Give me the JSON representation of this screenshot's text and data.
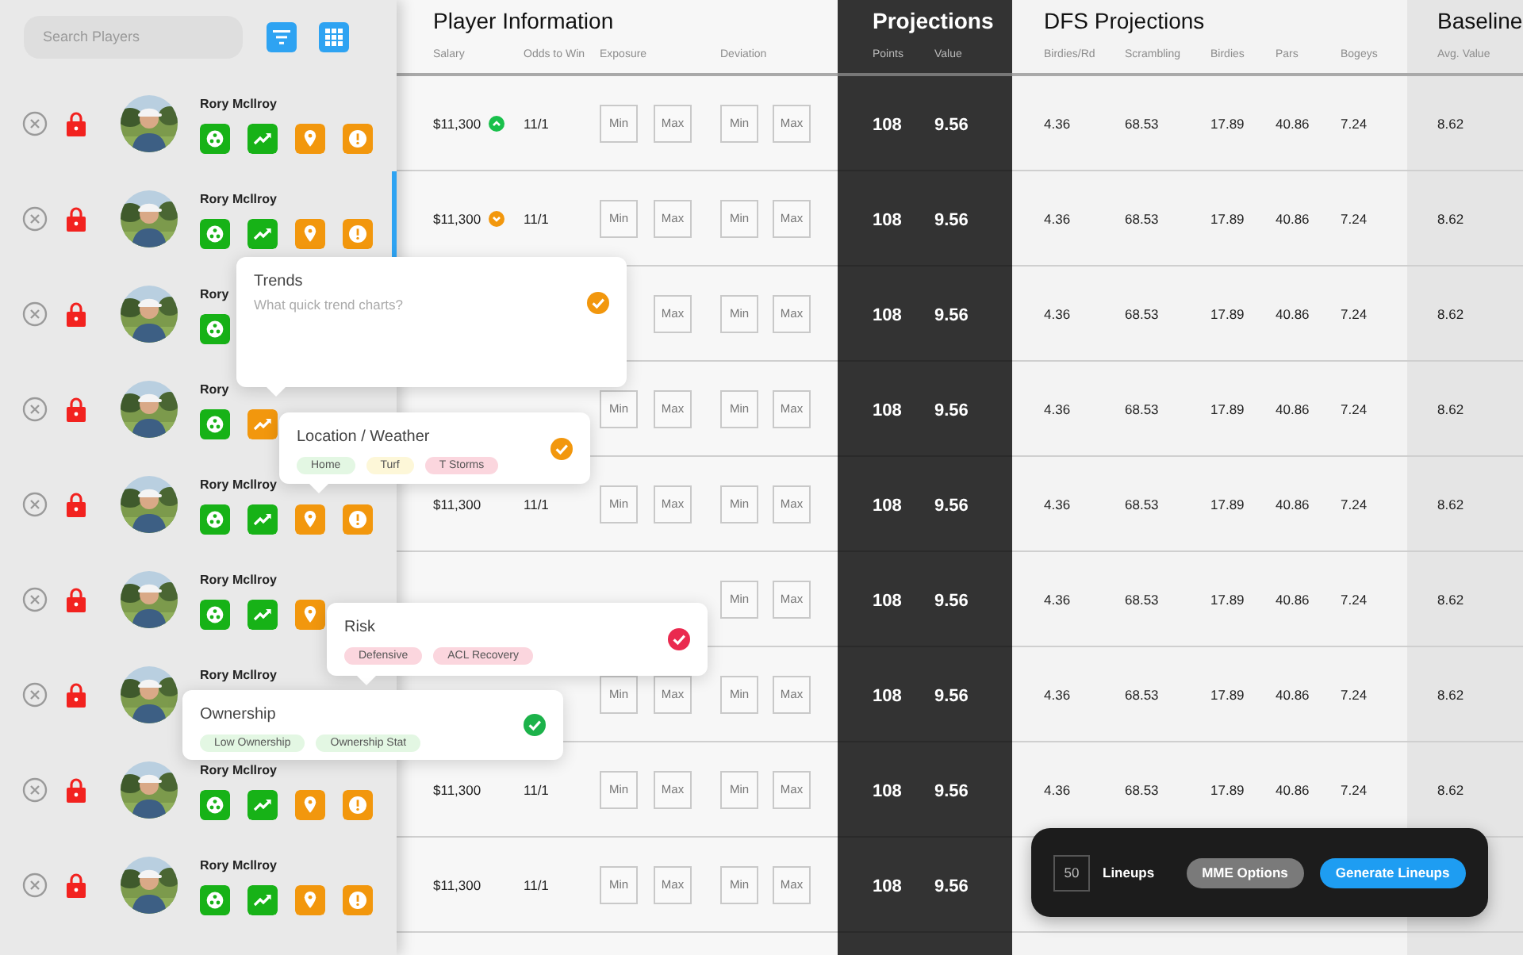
{
  "sidebar": {
    "search": {
      "placeholder": "Search Players"
    },
    "players": [
      {
        "name": "Rory Mcllroy",
        "icons": [
          {
            "kind": "people",
            "color": "#17b217"
          },
          {
            "kind": "trend",
            "color": "#17b217"
          },
          {
            "kind": "location",
            "color": "#f2970d"
          },
          {
            "kind": "alert",
            "color": "#f2970d"
          }
        ]
      },
      {
        "name": "Rory Mcllroy",
        "icons": [
          {
            "kind": "people",
            "color": "#17b217"
          },
          {
            "kind": "trend",
            "color": "#17b217"
          },
          {
            "kind": "location",
            "color": "#f2970d"
          },
          {
            "kind": "alert",
            "color": "#f2970d"
          }
        ]
      },
      {
        "name": "Rory",
        "icons": [
          {
            "kind": "people",
            "color": "#17b217"
          }
        ]
      },
      {
        "name": "Rory",
        "icons": [
          {
            "kind": "people",
            "color": "#17b217"
          },
          {
            "kind": "trend",
            "color": "#f2970d"
          }
        ]
      },
      {
        "name": "Rory Mcllroy",
        "icons": [
          {
            "kind": "people",
            "color": "#17b217"
          },
          {
            "kind": "trend",
            "color": "#17b217"
          },
          {
            "kind": "location",
            "color": "#f2970d"
          },
          {
            "kind": "alert",
            "color": "#f2970d"
          }
        ]
      },
      {
        "name": "Rory Mcllroy",
        "icons": [
          {
            "kind": "people",
            "color": "#17b217"
          },
          {
            "kind": "trend",
            "color": "#17b217"
          },
          {
            "kind": "location",
            "color": "#f2970d"
          }
        ]
      },
      {
        "name": "Rory Mcllroy"
      },
      {
        "name": "Rory Mcllroy",
        "icons": [
          {
            "kind": "people",
            "color": "#17b217"
          },
          {
            "kind": "trend",
            "color": "#17b217"
          },
          {
            "kind": "location",
            "color": "#f2970d"
          },
          {
            "kind": "alert",
            "color": "#f2970d"
          }
        ]
      },
      {
        "name": "Rory Mcllroy",
        "icons": [
          {
            "kind": "people",
            "color": "#17b217"
          },
          {
            "kind": "trend",
            "color": "#17b217"
          },
          {
            "kind": "location",
            "color": "#f2970d"
          },
          {
            "kind": "alert",
            "color": "#f2970d"
          }
        ]
      }
    ]
  },
  "sections": [
    {
      "kind": "info",
      "title": "Player Information",
      "columns": [
        "Salary",
        "Odds to Win",
        "Exposure",
        "Deviation"
      ]
    },
    {
      "kind": "projections",
      "title": "Projections",
      "columns": [
        "Points",
        "Value"
      ]
    },
    {
      "kind": "dfs",
      "title": "DFS Projections",
      "columns": [
        "Birdies/Rd",
        "Scrambling",
        "Birdies",
        "Pars",
        "Bogeys"
      ]
    },
    {
      "kind": "baseline",
      "title": "Baseline",
      "columns": [
        "Avg. Value"
      ]
    }
  ],
  "rows": [
    {
      "salary": "$11,300",
      "trend": {
        "kind": "up"
      },
      "odds": "11/1",
      "exposure": {
        "min": {
          "placeholder": "Min"
        },
        "max": {
          "placeholder": "Max"
        }
      },
      "deviation": {
        "min": {
          "placeholder": "Min"
        },
        "max": {
          "placeholder": "Max"
        }
      },
      "points": "108",
      "value": "9.56",
      "dfs": [
        "4.36",
        "68.53",
        "17.89",
        "40.86",
        "7.24"
      ],
      "baseline": "8.62"
    },
    {
      "salary": "$11,300",
      "trend": {
        "kind": "down"
      },
      "odds": "11/1",
      "exposure": {
        "min": {
          "placeholder": "Min"
        },
        "max": {
          "placeholder": "Max"
        }
      },
      "deviation": {
        "min": {
          "placeholder": "Min"
        },
        "max": {
          "placeholder": "Max"
        }
      },
      "points": "108",
      "value": "9.56",
      "dfs": [
        "4.36",
        "68.53",
        "17.89",
        "40.86",
        "7.24"
      ],
      "baseline": "8.62"
    },
    {
      "exposure": {
        "max": {
          "placeholder": "Max"
        }
      },
      "deviation": {
        "min": {
          "placeholder": "Min"
        },
        "max": {
          "placeholder": "Max"
        }
      },
      "points": "108",
      "value": "9.56",
      "dfs": [
        "4.36",
        "68.53",
        "17.89",
        "40.86",
        "7.24"
      ],
      "baseline": "8.62"
    },
    {
      "exposure": {
        "min": {
          "placeholder": "Min"
        },
        "max": {
          "placeholder": "Max"
        }
      },
      "deviation": {
        "min": {
          "placeholder": "Min"
        },
        "max": {
          "placeholder": "Max"
        }
      },
      "points": "108",
      "value": "9.56",
      "dfs": [
        "4.36",
        "68.53",
        "17.89",
        "40.86",
        "7.24"
      ],
      "baseline": "8.62"
    },
    {
      "salary": "$11,300",
      "odds": "11/1",
      "exposure": {
        "min": {
          "placeholder": "Min"
        },
        "max": {
          "placeholder": "Max"
        }
      },
      "deviation": {
        "min": {
          "placeholder": "Min"
        },
        "max": {
          "placeholder": "Max"
        }
      },
      "points": "108",
      "value": "9.56",
      "dfs": [
        "4.36",
        "68.53",
        "17.89",
        "40.86",
        "7.24"
      ],
      "baseline": "8.62"
    },
    {
      "deviation": {
        "min": {
          "placeholder": "Min"
        },
        "max": {
          "placeholder": "Max"
        }
      },
      "points": "108",
      "value": "9.56",
      "dfs": [
        "4.36",
        "68.53",
        "17.89",
        "40.86",
        "7.24"
      ],
      "baseline": "8.62"
    },
    {
      "exposure": {
        "min": {
          "placeholder": "Min"
        },
        "max": {
          "placeholder": "Max"
        }
      },
      "deviation": {
        "min": {
          "placeholder": "Min"
        },
        "max": {
          "placeholder": "Max"
        }
      },
      "points": "108",
      "value": "9.56",
      "dfs": [
        "4.36",
        "68.53",
        "17.89",
        "40.86",
        "7.24"
      ],
      "baseline": "8.62"
    },
    {
      "salary": "$11,300",
      "odds": "11/1",
      "exposure": {
        "min": {
          "placeholder": "Min"
        },
        "max": {
          "placeholder": "Max"
        }
      },
      "deviation": {
        "min": {
          "placeholder": "Min"
        },
        "max": {
          "placeholder": "Max"
        }
      },
      "points": "108",
      "value": "9.56",
      "dfs": [
        "4.36",
        "68.53",
        "17.89",
        "40.86",
        "7.24"
      ],
      "baseline": "8.62"
    },
    {
      "salary": "$11,300",
      "odds": "11/1",
      "exposure": {
        "min": {
          "placeholder": "Min"
        },
        "max": {
          "placeholder": "Max"
        }
      },
      "deviation": {
        "min": {
          "placeholder": "Min"
        },
        "max": {
          "placeholder": "Max"
        }
      },
      "points": "108",
      "value": "9.56"
    }
  ],
  "popovers": [
    {
      "kind": "note",
      "title": "Trends",
      "color": "#f2970d",
      "placeholder": "What quick trend charts?"
    },
    {
      "kind": "tags",
      "title": "Location / Weather",
      "color": "#f2970d",
      "tags": [
        {
          "label": "Home",
          "color": "#e3f7e3"
        },
        {
          "label": "Turf",
          "color": "#fdf7d8"
        },
        {
          "label": "T Storms",
          "color": "#fbd6de"
        }
      ]
    },
    {
      "kind": "tags",
      "title": "Risk",
      "color": "#ea2a4f",
      "tags": [
        {
          "label": "Defensive",
          "color": "#fbd6de"
        },
        {
          "label": "ACL Recovery",
          "color": "#fbd6de"
        }
      ]
    },
    {
      "kind": "tags",
      "title": "Ownership",
      "color": "#1cb24a",
      "tags": [
        {
          "label": "Low Ownership",
          "color": "#e3f7e3"
        },
        {
          "label": "Ownership Stat",
          "color": "#e3f7e3"
        }
      ]
    }
  ],
  "lineup_bar": {
    "count": "50",
    "label": "Lineups",
    "buttons": [
      {
        "kind": "secondary",
        "label": "MME Options"
      },
      {
        "kind": "primary",
        "label": "Generate Lineups"
      }
    ]
  }
}
